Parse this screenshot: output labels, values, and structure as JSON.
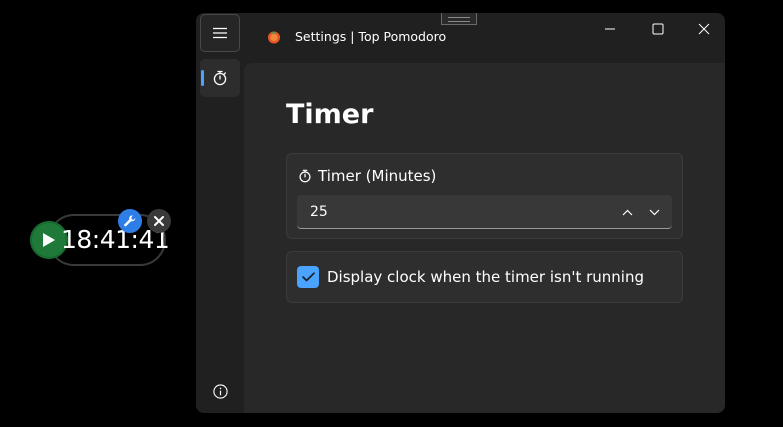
{
  "widget": {
    "time": "18:41:41",
    "colors": {
      "play": "#1f7a3a",
      "wrench": "#2f7ee8",
      "close": "#3a3a3a"
    }
  },
  "window": {
    "title": "Settings | Top Pomodoro",
    "app_icon": "tomato-icon"
  },
  "nav": {
    "items": [
      {
        "icon": "timer-icon",
        "selected": true
      }
    ],
    "footer_icon": "info-icon",
    "accent": "#4aa3ff"
  },
  "page": {
    "title": "Timer"
  },
  "timer_card": {
    "label": "Timer (Minutes)",
    "value": "25"
  },
  "clock_card": {
    "label": "Display clock when the timer isn't running",
    "checked": true
  }
}
